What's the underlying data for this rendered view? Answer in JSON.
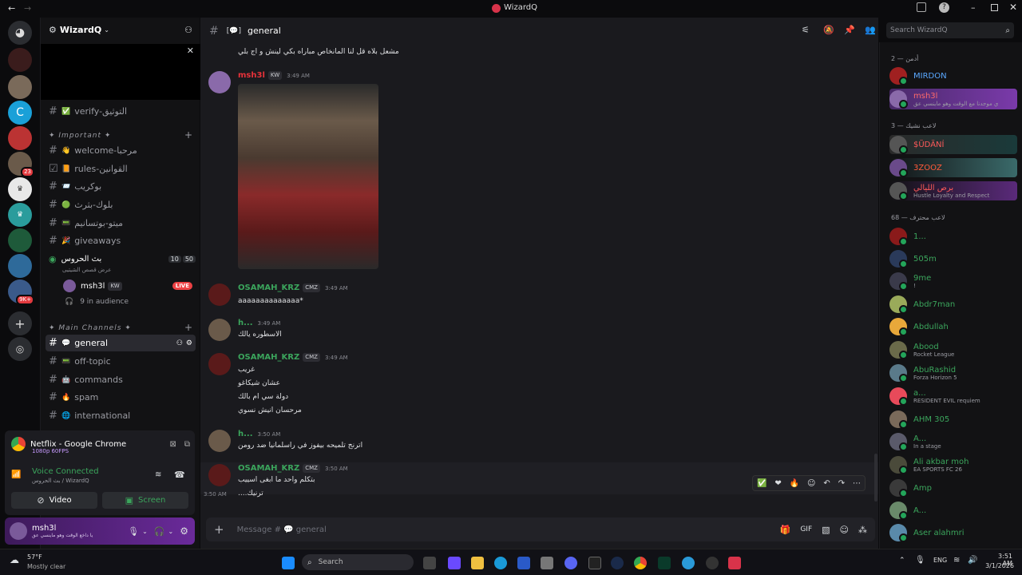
{
  "window": {
    "title": "WizardQ"
  },
  "server": {
    "name": "WizardQ",
    "channel_icon_text": "verify-التوثيق"
  },
  "guild_badges": {
    "b1": "23",
    "b2": "9K+"
  },
  "categories": {
    "important": "✦ Important ✦",
    "main": "✦ Main Channels ✦"
  },
  "channels": [
    {
      "name": "verify-التوثيق",
      "emoji": "✅"
    },
    {
      "name": "welcome-مرحبا",
      "emoji": "👋"
    },
    {
      "name": "rules-القوانين",
      "emoji": "📙"
    },
    {
      "name": "بوكريب",
      "emoji": "📨"
    },
    {
      "name": "بلوك-بثرث",
      "emoji": "🟢"
    },
    {
      "name": "ميتو-بوتسانيم",
      "emoji": "📟"
    },
    {
      "name": "giveaways",
      "emoji": "🎉"
    }
  ],
  "voice": {
    "name": "بث الحروس",
    "sub": "عرض قصص الشيتيى",
    "video_count": "10",
    "limit": "50",
    "user": "msh3l",
    "user_tag": "KW",
    "live": "LIVE",
    "audience": "9 in audience"
  },
  "main_channels": [
    {
      "name": "general",
      "emoji": "💬"
    },
    {
      "name": "off-topic",
      "emoji": "📟"
    },
    {
      "name": "commands",
      "emoji": "🤖"
    },
    {
      "name": "spam",
      "emoji": "🔥"
    },
    {
      "name": "international",
      "emoji": "🌐"
    }
  ],
  "stream": {
    "title": "Netflix - Google Chrome",
    "quality": "1080p 60FPS"
  },
  "connection": {
    "status": "Voice Connected",
    "location": "بث الحروس / WizardQ",
    "video": "Video",
    "screen": "Screen"
  },
  "me": {
    "name": "msh3l",
    "status": "يا داخع الوقت وهو ماينسي عق"
  },
  "header": {
    "channel": "general",
    "search_placeholder": "Search WizardQ"
  },
  "messages": [
    {
      "user": "",
      "time": "",
      "lines": [
        "مشعل بلاه قل لنا المانخاص مباراه بكي لينش و اج بلي"
      ]
    },
    {
      "user": "msh3l",
      "tag": "KW",
      "time": "3:49 AM",
      "lines": []
    },
    {
      "user": "OSAMAH_KRZ",
      "tag": "CMZ",
      "time": "3:49 AM",
      "lines": [
        "aaaaaaaaaaaaaa*"
      ]
    },
    {
      "user": "h...",
      "tag": "",
      "time": "3:49 AM",
      "lines": [
        "الاسطوره يالك"
      ]
    },
    {
      "user": "OSAMAH_KRZ",
      "tag": "CMZ",
      "time": "3:49 AM",
      "lines": [
        "غريب",
        "عشان شيكاغو",
        "دولة سي ام بالك",
        "مرحسان انيش نسوي"
      ]
    },
    {
      "user": "h...",
      "tag": "",
      "time": "3:50 AM",
      "lines": [
        "اترنج تلميحه بيفوز في راسلمانيا ضد رومن"
      ]
    },
    {
      "user": "OSAMAH_KRZ",
      "tag": "CMZ",
      "time": "3:50 AM",
      "lines": [
        "بتكلم واحد ما ابغى اسييب"
      ]
    },
    {
      "user": "",
      "tag": "",
      "time": "3:50 AM",
      "lines": [
        "....ترنيك"
      ]
    }
  ],
  "composer": {
    "placeholder": "Message # 💬 general"
  },
  "members": {
    "sections": [
      "2 — أدمن",
      "3 — لاعب نشيك",
      "68 — لاعب محترف"
    ],
    "list": [
      {
        "name": "MIRDON",
        "sub": ""
      },
      {
        "name": "msh3l",
        "sub": "ي موجدنا مع الوقت وهو ماينسي عق"
      },
      {
        "name": "$ÜDÄNÍ",
        "sub": ""
      },
      {
        "name": "3ZOOZ",
        "sub": ""
      },
      {
        "name": "برص الليالي",
        "sub": "Hustle Loyalty and Respect"
      },
      {
        "name": "1...",
        "sub": ""
      },
      {
        "name": "505m",
        "sub": ""
      },
      {
        "name": "9me",
        "sub": "!"
      },
      {
        "name": "Abdr7man",
        "sub": ""
      },
      {
        "name": "Abdullah",
        "sub": ""
      },
      {
        "name": "Abood",
        "sub": "Rocket League"
      },
      {
        "name": "AbuRashid",
        "sub": "Forza Horizon 5"
      },
      {
        "name": "a...",
        "sub": "RESIDENT EVIL requiem"
      },
      {
        "name": "AHM 305",
        "sub": ""
      },
      {
        "name": "A...",
        "sub": "In a stage"
      },
      {
        "name": "Ali akbar moh",
        "sub": "EA SPORTS FC 26"
      },
      {
        "name": "Amp",
        "sub": ""
      },
      {
        "name": "A...",
        "sub": ""
      },
      {
        "name": "Aser alahmri",
        "sub": ""
      }
    ]
  },
  "taskbar": {
    "weather_temp": "57°F",
    "weather_desc": "Mostly clear",
    "search": "Search",
    "lang": "ENG",
    "time": "3:51 AM",
    "date": "3/1/2026"
  },
  "colors": {
    "accent": "#5865f2",
    "green": "#3ba55c",
    "live": "#ed4245"
  }
}
